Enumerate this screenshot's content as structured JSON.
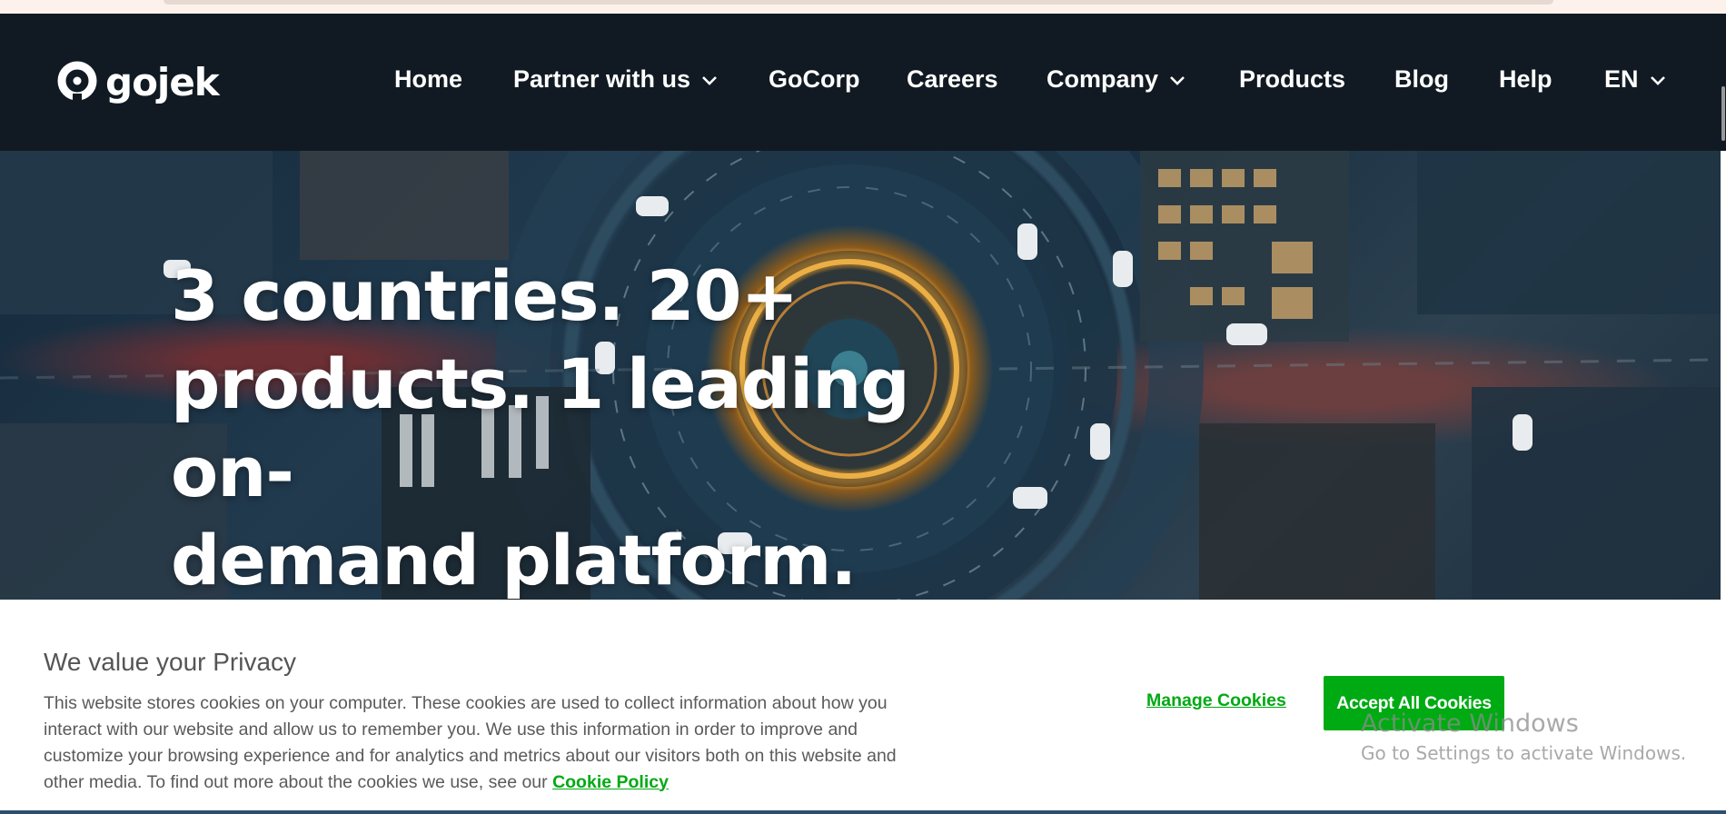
{
  "brand": {
    "logo_text": "gojek"
  },
  "nav": {
    "items": [
      {
        "label": "Home",
        "has_dropdown": false
      },
      {
        "label": "Partner with us",
        "has_dropdown": true
      },
      {
        "label": "GoCorp",
        "has_dropdown": false
      },
      {
        "label": "Careers",
        "has_dropdown": false
      },
      {
        "label": "Company",
        "has_dropdown": true
      },
      {
        "label": "Products",
        "has_dropdown": false
      },
      {
        "label": "Blog",
        "has_dropdown": false
      },
      {
        "label": "Help",
        "has_dropdown": false
      },
      {
        "label": "EN",
        "has_dropdown": true
      }
    ]
  },
  "hero": {
    "title_line1": "3 countries. 20+",
    "title_line2": "products. 1 leading on-",
    "title_line3": "demand platform."
  },
  "cookie_banner": {
    "title": "We value your Privacy",
    "body": "This website stores cookies on your computer. These cookies are used to collect information about how you interact with our website and allow us to remember you. We use this information in order to improve and customize your browsing experience and for analytics and metrics about our visitors both on this website and other media. To find out more about the cookies we use, see our",
    "policy_link": "Cookie Policy",
    "manage_label": "Manage Cookies",
    "accept_label": "Accept All Cookies"
  },
  "windows_watermark": {
    "line1": "Activate Windows",
    "line2": "Go to Settings to activate Windows."
  },
  "colors": {
    "nav_bg": "#111a22",
    "accent_green": "#00aa13",
    "body_text": "#5a5a5a"
  }
}
